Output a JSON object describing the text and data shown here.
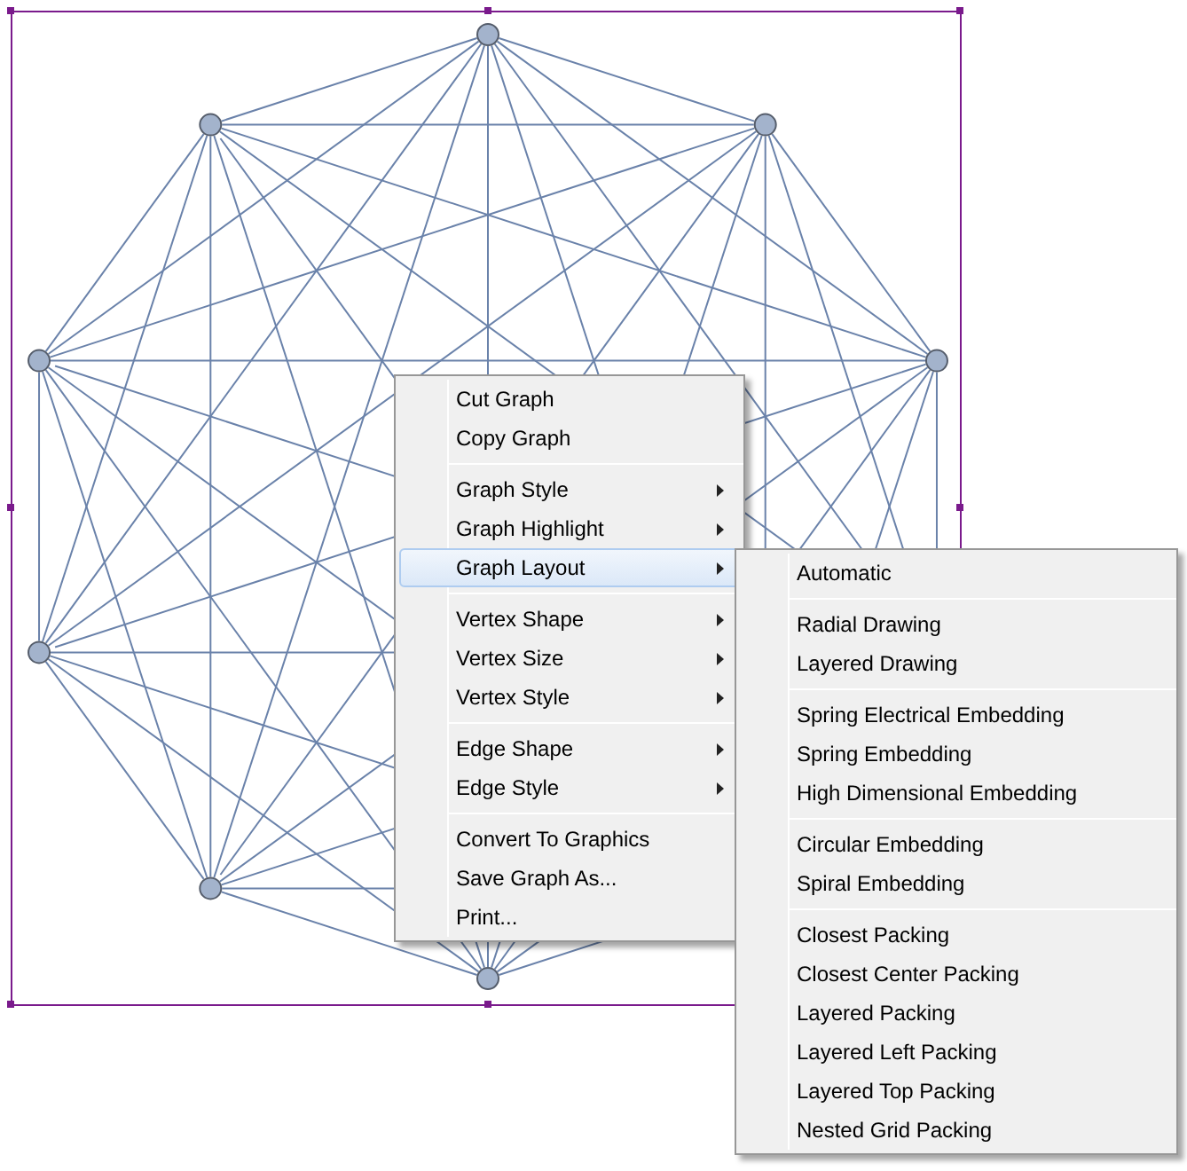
{
  "context_menu": {
    "groups": [
      [
        {
          "label": "Cut Graph",
          "submenu": false,
          "selected": false
        },
        {
          "label": "Copy Graph",
          "submenu": false,
          "selected": false
        }
      ],
      [
        {
          "label": "Graph Style",
          "submenu": true,
          "selected": false
        },
        {
          "label": "Graph Highlight",
          "submenu": true,
          "selected": false
        },
        {
          "label": "Graph Layout",
          "submenu": true,
          "selected": true
        }
      ],
      [
        {
          "label": "Vertex Shape",
          "submenu": true,
          "selected": false
        },
        {
          "label": "Vertex Size",
          "submenu": true,
          "selected": false
        },
        {
          "label": "Vertex Style",
          "submenu": true,
          "selected": false
        }
      ],
      [
        {
          "label": "Edge Shape",
          "submenu": true,
          "selected": false
        },
        {
          "label": "Edge Style",
          "submenu": true,
          "selected": false
        }
      ],
      [
        {
          "label": "Convert To Graphics",
          "submenu": false,
          "selected": false
        },
        {
          "label": "Save Graph As...",
          "submenu": false,
          "selected": false
        },
        {
          "label": "Print...",
          "submenu": false,
          "selected": false
        }
      ]
    ]
  },
  "submenu": {
    "groups": [
      [
        {
          "label": "Automatic",
          "submenu": false,
          "selected": false
        }
      ],
      [
        {
          "label": "Radial Drawing",
          "submenu": false,
          "selected": false
        },
        {
          "label": "Layered Drawing",
          "submenu": false,
          "selected": false
        }
      ],
      [
        {
          "label": "Spring Electrical Embedding",
          "submenu": false,
          "selected": false
        },
        {
          "label": "Spring Embedding",
          "submenu": false,
          "selected": false
        },
        {
          "label": "High Dimensional Embedding",
          "submenu": false,
          "selected": false
        }
      ],
      [
        {
          "label": "Circular Embedding",
          "submenu": false,
          "selected": false
        },
        {
          "label": "Spiral Embedding",
          "submenu": false,
          "selected": false
        }
      ],
      [
        {
          "label": "Closest Packing",
          "submenu": false,
          "selected": false
        },
        {
          "label": "Closest Center Packing",
          "submenu": false,
          "selected": false
        },
        {
          "label": "Layered Packing",
          "submenu": false,
          "selected": false
        },
        {
          "label": "Layered Left Packing",
          "submenu": false,
          "selected": false
        },
        {
          "label": "Layered Top Packing",
          "submenu": false,
          "selected": false
        },
        {
          "label": "Nested Grid Packing",
          "submenu": false,
          "selected": false
        }
      ]
    ]
  }
}
